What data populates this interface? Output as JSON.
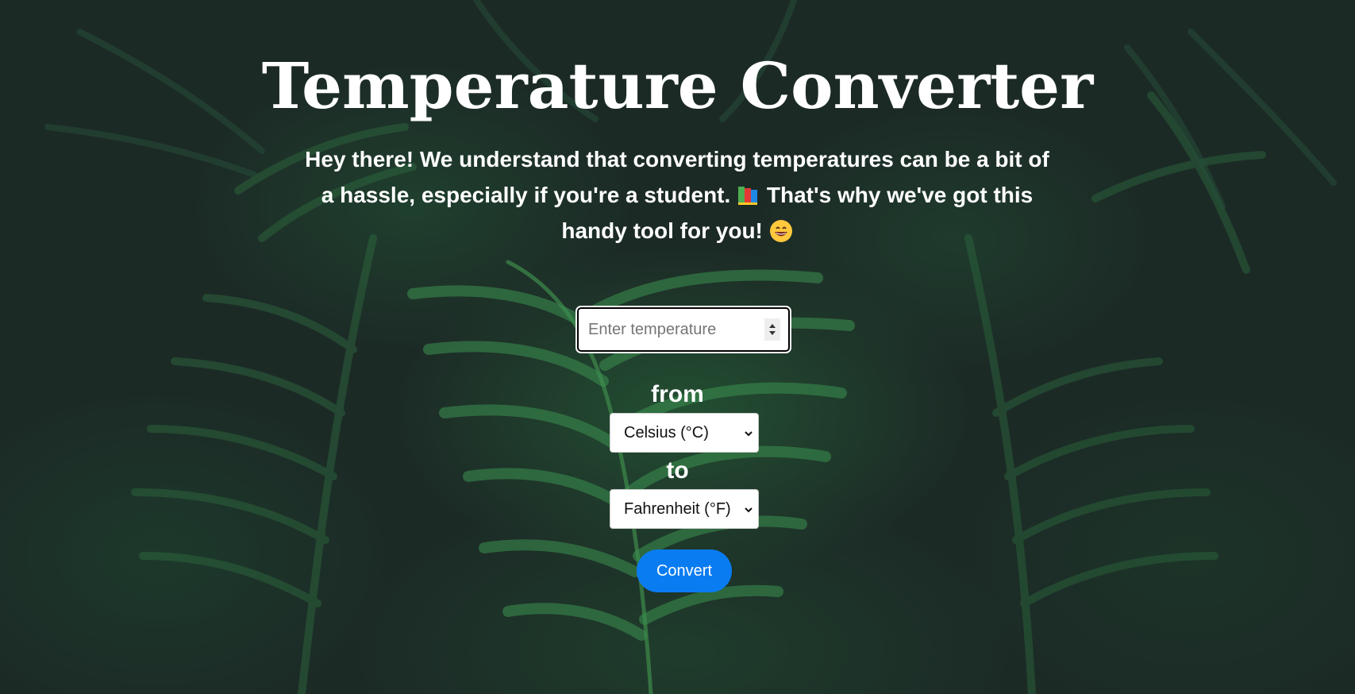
{
  "page": {
    "title": "Temperature Converter",
    "intro_part1": "Hey there! We understand that converting temperatures can be a bit of a hassle, especially if you're a student.",
    "intro_part2": "That's why we've got this handy tool for you!",
    "intro_emoji_1": "books-emoji",
    "intro_emoji_2": "grinning-face-emoji"
  },
  "form": {
    "temperature_placeholder": "Enter temperature",
    "temperature_value": "",
    "from_label": "from",
    "from_selected": "Celsius (°C)",
    "to_label": "to",
    "to_selected": "Fahrenheit (°F)",
    "convert_label": "Convert"
  },
  "colors": {
    "button": "#0a7cf2",
    "text": "#ffffff",
    "background": "#1c2a26"
  }
}
